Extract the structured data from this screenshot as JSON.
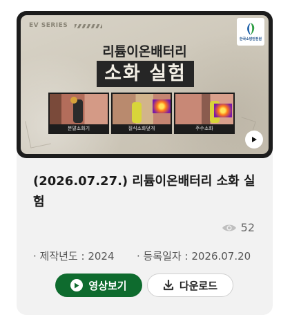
{
  "thumbnail": {
    "series_tag": "EV SERIES",
    "logo_text": "한국소방안전원",
    "headline_line1": "리튬이온배터리",
    "headline_line2": "소화 실험",
    "panels": [
      {
        "caption": "분말소화기"
      },
      {
        "caption": "질식소화덮개"
      },
      {
        "caption": "주수소화"
      }
    ]
  },
  "card": {
    "title": "(2026.07.27.) 리튬이온배터리 소화 실험",
    "views": "52",
    "production_year": "· 제작년도 : 2024",
    "registration_date": "· 등록일자 : 2026.07.20"
  },
  "actions": {
    "watch_label": "영상보기",
    "download_label": "다운로드"
  },
  "colors": {
    "accent_green": "#0e6b2e",
    "card_bg": "#f2f2f2"
  }
}
